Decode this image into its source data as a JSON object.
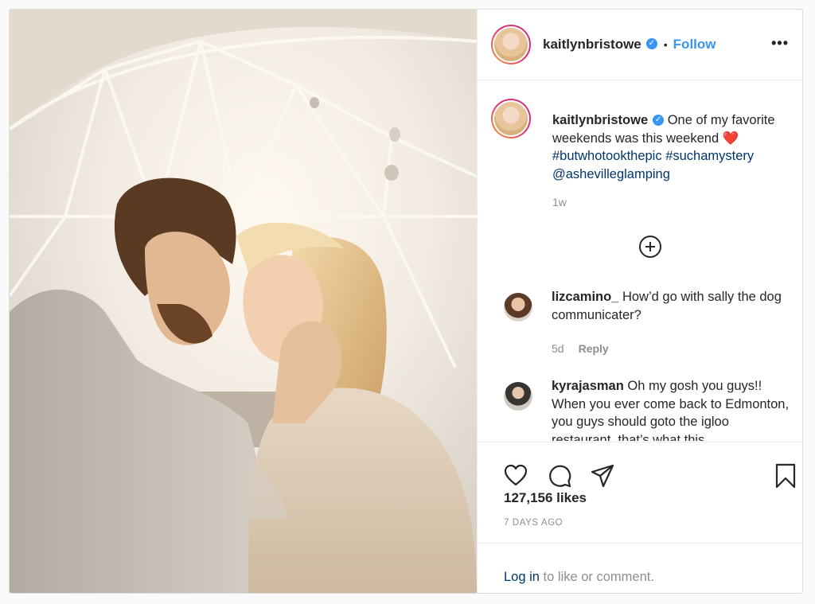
{
  "post": {
    "username": "kaitlynbristowe",
    "follow_label": "Follow",
    "separator": "•",
    "more_icon": "more-options-icon",
    "more_glyph": "•••",
    "verified_glyph": "✓"
  },
  "caption": {
    "username": "kaitlynbristowe",
    "text_start": "One of my favorite weekends was this weekend",
    "heart": "❤️",
    "tag1": "#butwhotookthepic",
    "tag2": "#suchamystery",
    "mention": "@ashevilleglamping",
    "age": "1w"
  },
  "comments": [
    {
      "username": "lizcamino_",
      "text": "How’d go with sally the dog communicater?",
      "age": "5d",
      "reply_label": "Reply"
    },
    {
      "username": "kyrajasman",
      "text": "Oh my gosh you guys!! When you ever come back to Edmonton, you guys should goto the igloo restaurant, that’s what this",
      "age": "",
      "reply_label": ""
    }
  ],
  "actions": {
    "icons": [
      "heart-icon",
      "comment-icon",
      "share-icon",
      "bookmark-icon"
    ],
    "likes": "127,156 likes",
    "date": "7 DAYS AGO"
  },
  "login": {
    "link": "Log in",
    "rest": " to like or comment."
  },
  "colors": {
    "link": "#3897f0",
    "hashtag": "#00376b",
    "muted": "#8e8e8e",
    "text": "#262626"
  }
}
